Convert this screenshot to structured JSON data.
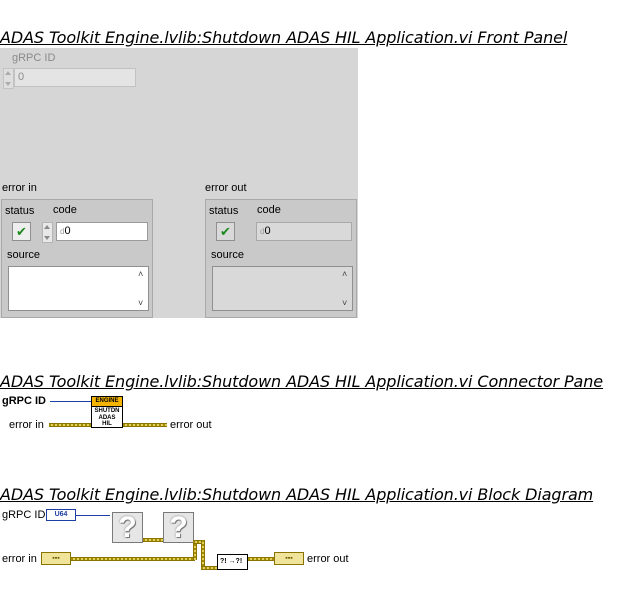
{
  "front_panel": {
    "title": "ADAS Toolkit Engine.lvlib:Shutdown ADAS HIL Application.vi Front Panel",
    "grpc_id": {
      "label": "gRPC ID",
      "value": "0"
    },
    "error_in": {
      "label": "error in",
      "status_label": "status",
      "code_label": "code",
      "code_value": "0",
      "source_label": "source",
      "status_glyph": "✔"
    },
    "error_out": {
      "label": "error out",
      "status_label": "status",
      "code_label": "code",
      "code_prefix": "d",
      "code_value": "0",
      "source_label": "source",
      "status_glyph": "✔"
    },
    "scroll_up_glyph": "˄",
    "scroll_down_glyph": "˅",
    "numeric_radix_glyph": "d"
  },
  "connector_pane": {
    "title": "ADAS Toolkit Engine.lvlib:Shutdown ADAS HIL Application.vi Connector Pane",
    "grpc_id_label": "gRPC ID",
    "error_in_label": "error in",
    "error_out_label": "error out",
    "icon_banner": "ENGINE",
    "icon_text_lines": [
      "SHUTDN",
      "ADAS",
      "HIL"
    ]
  },
  "block_diagram": {
    "title": "ADAS Toolkit Engine.lvlib:Shutdown ADAS HIL Application.vi Block Diagram",
    "grpc_id_label": "gRPC ID",
    "grpc_type": "U64",
    "error_in_label": "error in",
    "error_out_label": "error out",
    "unknown_node_glyph": "?",
    "merge_node_text": "?! →?!",
    "cluster_terminal_glyph": "▪▪▪"
  },
  "colors": {
    "panel_bg": "#d6d6d6",
    "cluster_bg": "#c9c9c9",
    "numeric_wire": "#1f3fa5",
    "error_wire": "#a48b00",
    "status_ok": "#1e8a1e",
    "icon_banner": "#f4b400"
  }
}
